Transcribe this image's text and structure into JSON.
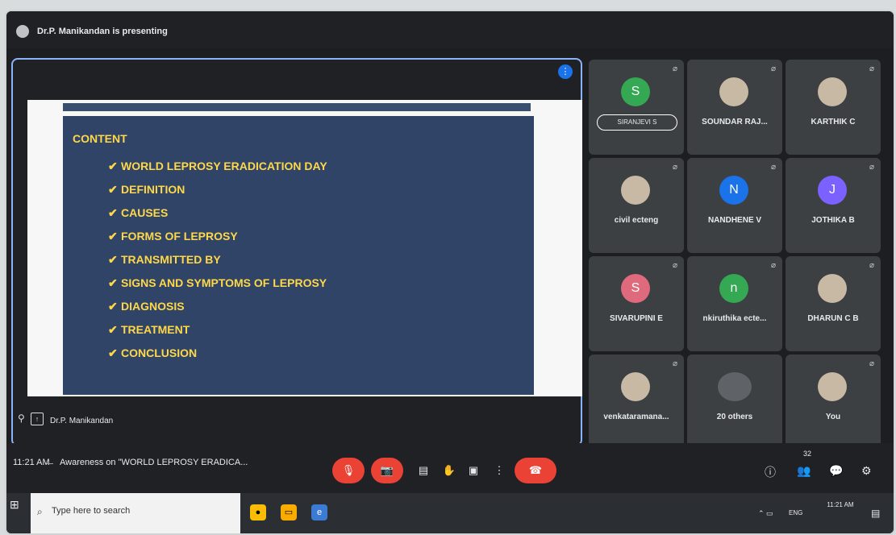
{
  "header": {
    "presenter_text": "Dr.P. Manikandan is presenting"
  },
  "stage": {
    "slide_heading": "CONTENT",
    "slide_items": [
      "WORLD LEPROSY ERADICATION DAY",
      "DEFINITION",
      "CAUSES",
      "FORMS OF LEPROSY",
      "TRANSMITTED BY",
      "SIGNS AND SYMPTOMS OF LEPROSY",
      "DIAGNOSIS",
      "TREATMENT",
      "CONCLUSION"
    ],
    "presenter_name": "Dr.P. Manikandan"
  },
  "tiles": [
    {
      "name": "SIRANJEVI S",
      "initial": "S",
      "color": "#34a853"
    },
    {
      "name": "SOUNDAR RAJ...",
      "initial": "",
      "color": ""
    },
    {
      "name": "KARTHIK C",
      "initial": "",
      "color": ""
    },
    {
      "name": "civil ecteng",
      "initial": "",
      "color": ""
    },
    {
      "name": "NANDHENE V",
      "initial": "N",
      "color": "#1a73e8"
    },
    {
      "name": "JOTHIKA B",
      "initial": "J",
      "color": "#7b61ff"
    },
    {
      "name": "SIVARUPINI E",
      "initial": "S",
      "color": "#e06a7d"
    },
    {
      "name": "nkiruthika ecte...",
      "initial": "n",
      "color": "#34a853"
    },
    {
      "name": "DHARUN C B",
      "initial": "",
      "color": ""
    },
    {
      "name": "venkataramana...",
      "initial": "",
      "color": ""
    },
    {
      "name": "20 others",
      "initial": "",
      "color": ""
    },
    {
      "name": "You",
      "initial": "",
      "color": ""
    }
  ],
  "meeting_bar": {
    "time": "11:21 AM",
    "title": "Awareness on \"WORLD LEPROSY ERADICA...",
    "participants_count": "32"
  },
  "taskbar": {
    "search_placeholder": "Type here to search",
    "lang": "ENG",
    "time": "11:21 AM"
  },
  "colors": {
    "accent": "#8ab4f8",
    "danger": "#ea4335",
    "slide_bg": "#2f4466",
    "slide_text": "#ffd84a"
  }
}
